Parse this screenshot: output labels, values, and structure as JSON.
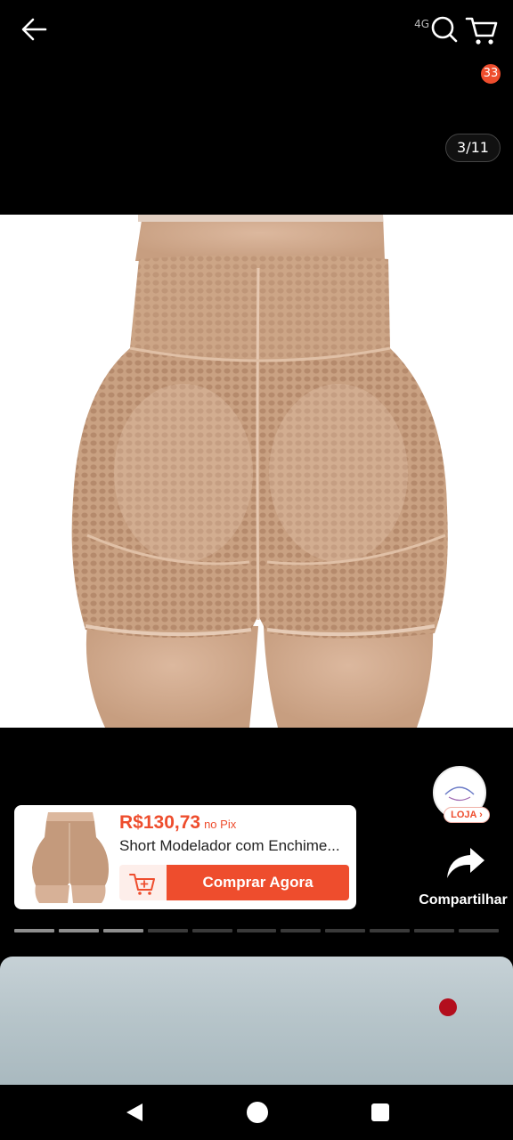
{
  "status_bar": {
    "network_label": "4G"
  },
  "top_bar": {
    "back_icon": "arrow-left-icon",
    "search_icon": "search-icon",
    "cart_icon": "cart-icon",
    "cart_count": "33"
  },
  "gallery": {
    "page_counter": "3/11",
    "current_index": 3,
    "total": 11
  },
  "store": {
    "button_label": "LOJA"
  },
  "share": {
    "label": "Compartilhar",
    "icon": "share-arrow-icon"
  },
  "product_card": {
    "price": "R$130,73",
    "price_suffix": "no Pix",
    "title": "Short Modelador com Enchime...",
    "add_to_cart_icon": "cart-plus-icon",
    "buy_label": "Comprar Agora"
  },
  "video_progress": {
    "segments_total": 11,
    "segments_completed": 3
  },
  "colors": {
    "accent": "#ee4d2d",
    "background": "#000000",
    "product_skin_tone": "#c9a182"
  }
}
